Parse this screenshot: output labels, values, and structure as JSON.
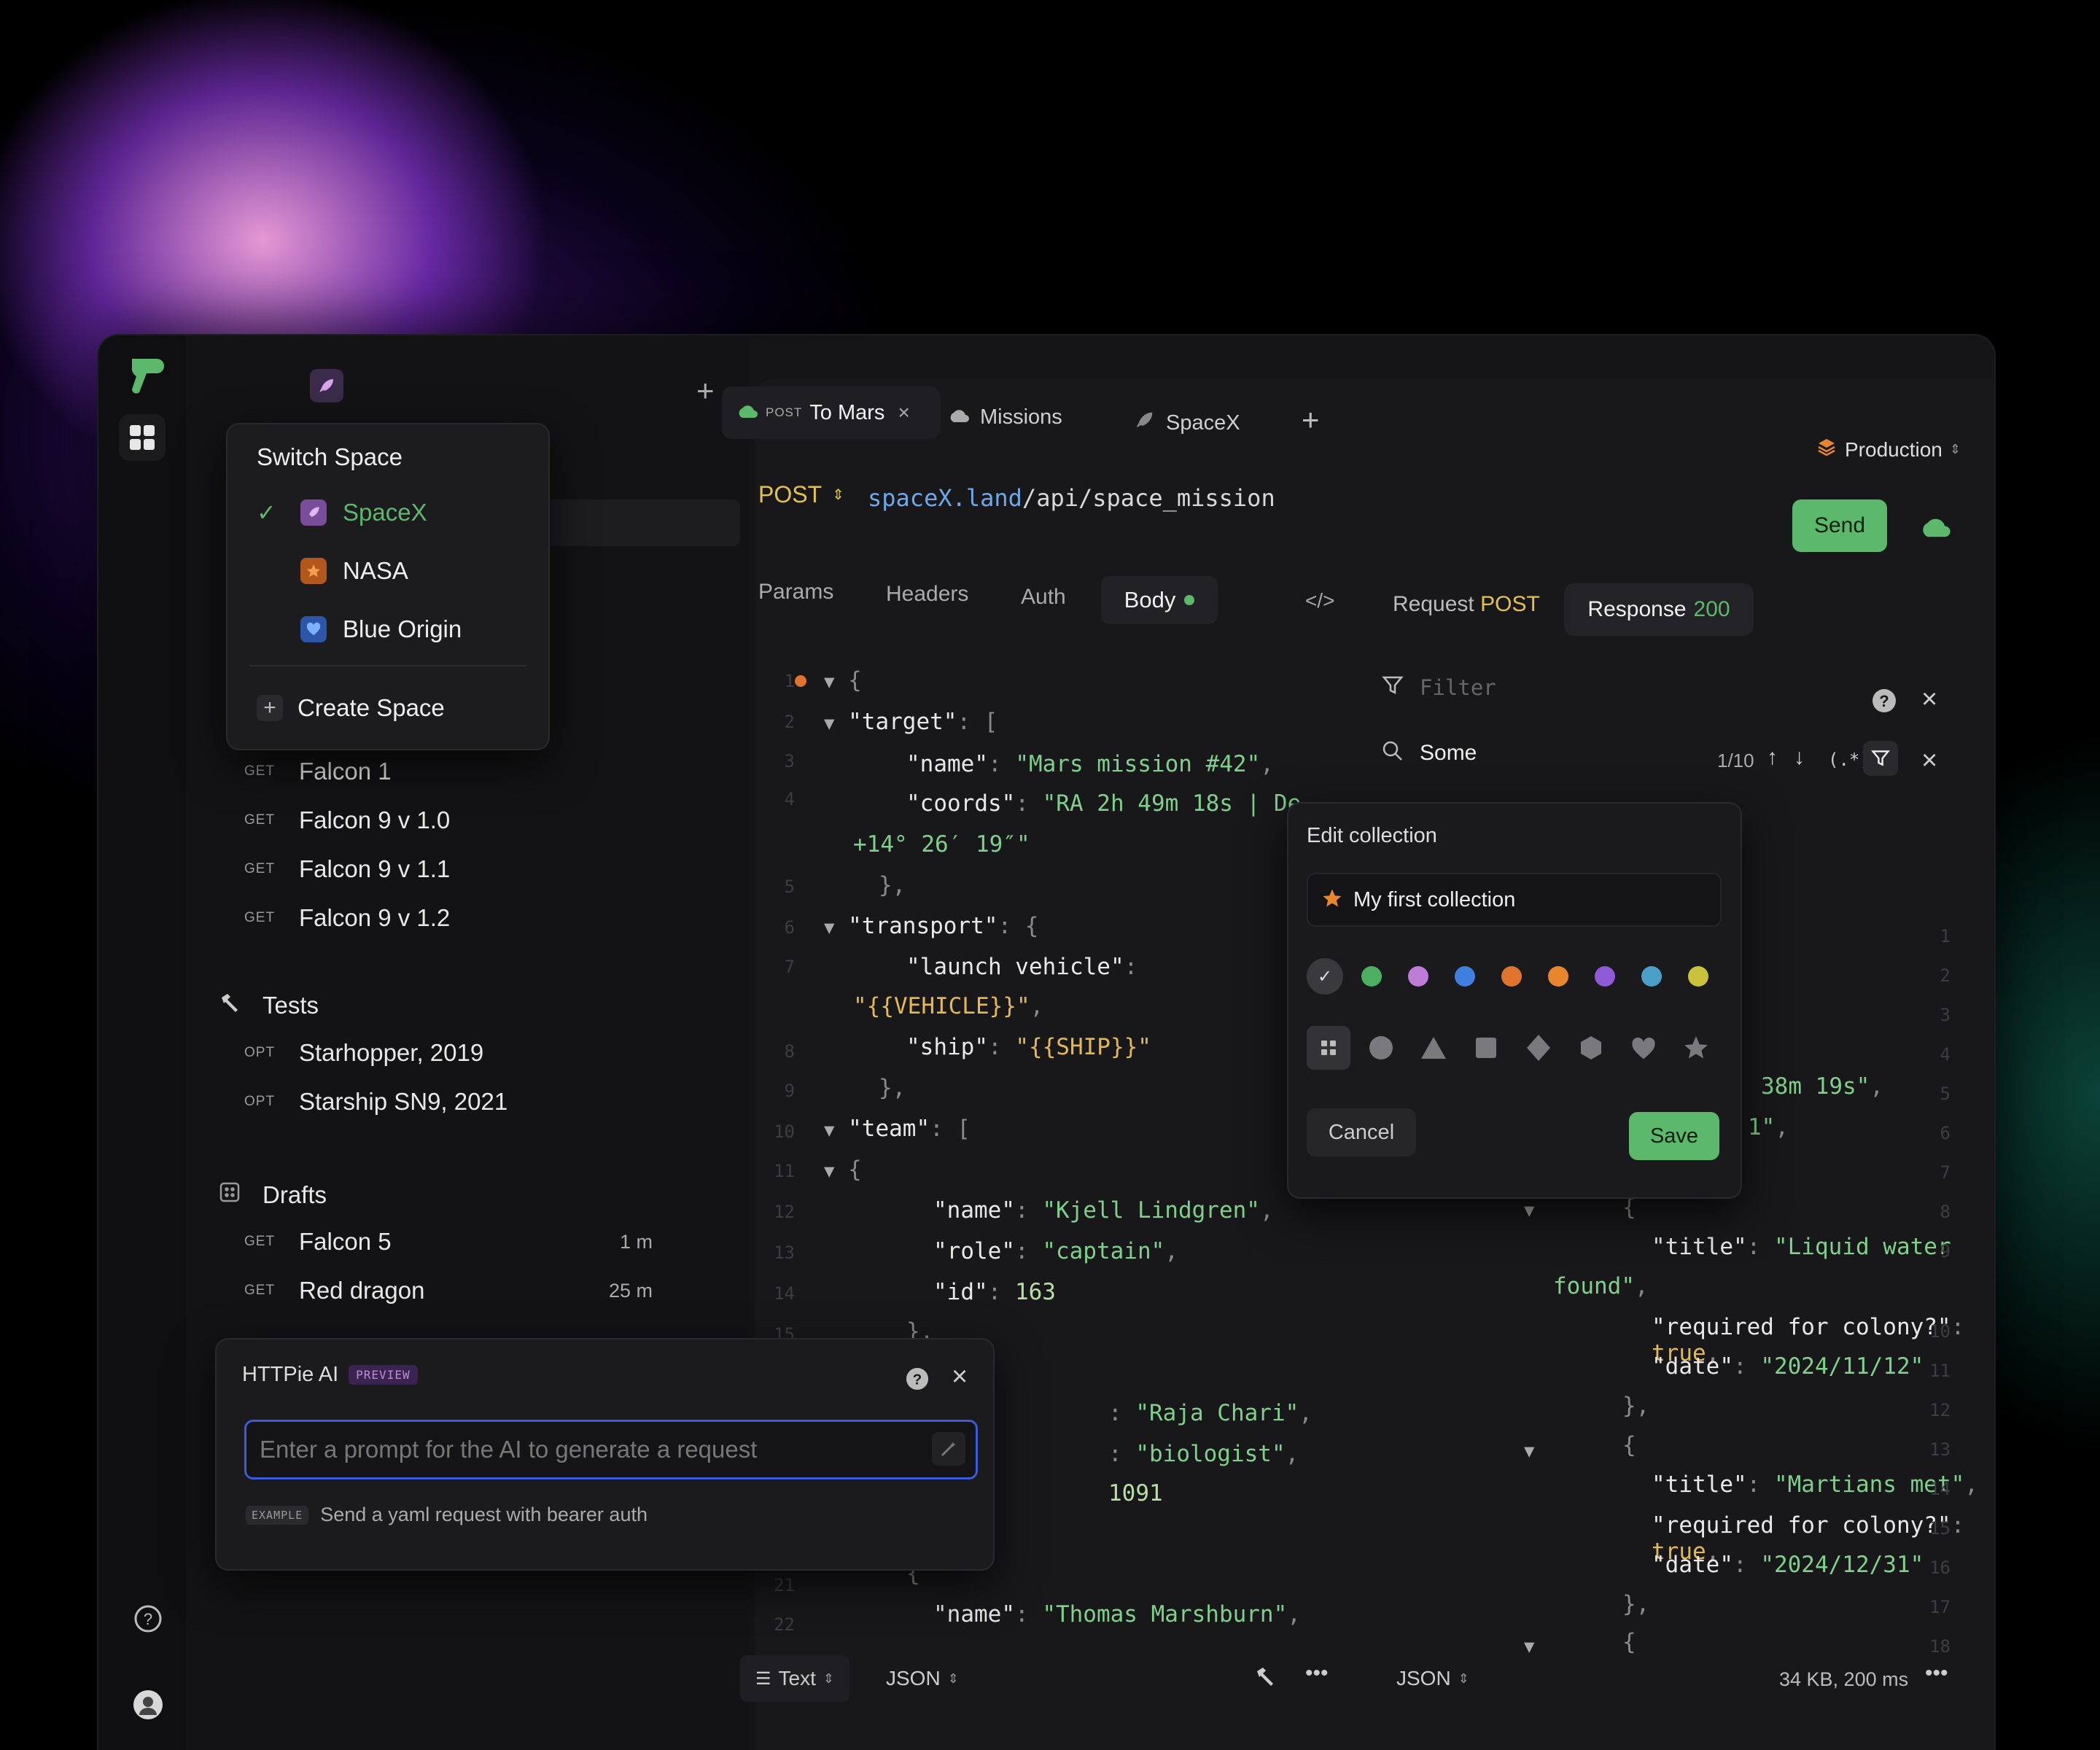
{
  "colors": {
    "accent_green": "#5cb86a",
    "method_post": "#e4c24a",
    "url_host": "#6fa8e8",
    "string": "#7ed08a",
    "ai_border": "#3b5bdc"
  },
  "sidebar": {
    "switcher": {
      "title": "Switch Space",
      "spaces": [
        {
          "label": "SpaceX",
          "selected": true,
          "icon": "rocket-icon"
        },
        {
          "label": "NASA",
          "selected": false,
          "icon": "star-icon"
        },
        {
          "label": "Blue Origin",
          "selected": false,
          "icon": "heart-icon"
        }
      ],
      "create_label": "Create Space"
    },
    "items_top": [
      {
        "method": "GET",
        "label": "Falcon 1"
      },
      {
        "method": "GET",
        "label": "Falcon 9 v 1.0"
      },
      {
        "method": "GET",
        "label": "Falcon 9 v 1.1"
      },
      {
        "method": "GET",
        "label": "Falcon 9 v 1.2"
      }
    ],
    "tests": {
      "title": "Tests",
      "items": [
        {
          "method": "OPT",
          "label": "Starhopper, 2019"
        },
        {
          "method": "OPT",
          "label": "Starship SN9, 2021"
        }
      ]
    },
    "drafts": {
      "title": "Drafts",
      "items": [
        {
          "method": "GET",
          "label": "Falcon 5",
          "time": "1 m"
        },
        {
          "method": "GET",
          "label": "Red dragon",
          "time": "25 m"
        }
      ]
    }
  },
  "ai": {
    "title": "HTTPie AI",
    "badge": "PREVIEW",
    "placeholder": "Enter a prompt for the AI to generate a request",
    "example_badge": "EXAMPLE",
    "example_text": "Send a yaml request with bearer auth"
  },
  "tabs": [
    {
      "method": "POST",
      "label": "To Mars",
      "active": true
    },
    {
      "label": "Missions"
    },
    {
      "label": "SpaceX"
    }
  ],
  "environment": "Production",
  "request": {
    "method": "POST",
    "url_host": "spaceX.land",
    "url_path": "/api/space_mission",
    "send_label": "Send"
  },
  "request_tabs": [
    "Params",
    "Headers",
    "Auth",
    "Body"
  ],
  "response_tabs": {
    "request_label": "Request",
    "request_method": "POST",
    "response_label": "Response",
    "response_status": "200"
  },
  "filter": {
    "placeholder": "Filter",
    "search_value": "Some",
    "match_count": "1/10"
  },
  "edit_collection": {
    "title": "Edit collection",
    "name": "My first collection",
    "colors": [
      "#8a8a8a",
      "#4caf62",
      "#c07ad8",
      "#3f7fe0",
      "#e0742e",
      "#e8862e",
      "#8f5ad8",
      "#4aa0c8",
      "#c9c23a"
    ],
    "shapes": [
      "grid-icon",
      "circle-icon",
      "triangle-icon",
      "square-icon",
      "diamond-icon",
      "hexagon-icon",
      "heart-icon",
      "star-icon"
    ],
    "cancel_label": "Cancel",
    "save_label": "Save"
  },
  "footer": {
    "left_mode": "Text",
    "left_format": "JSON",
    "right_format": "JSON",
    "stats": "34 KB, 200 ms"
  }
}
